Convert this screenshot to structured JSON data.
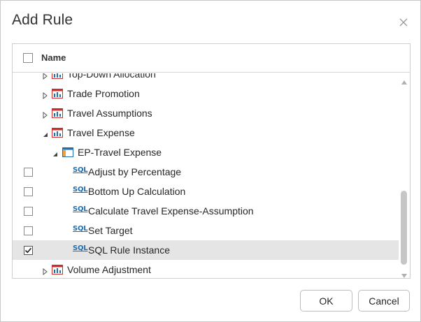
{
  "dialog": {
    "title": "Add Rule",
    "close_icon": "close-icon"
  },
  "grid": {
    "header": {
      "name_label": "Name",
      "select_all_checked": false
    },
    "rows": [
      {
        "label": "Top-Down Allocation",
        "type": "cube",
        "expanded": false,
        "icon": "cube-chart-icon"
      },
      {
        "label": "Trade Promotion",
        "type": "cube",
        "expanded": false,
        "icon": "cube-chart-icon"
      },
      {
        "label": "Travel Assumptions",
        "type": "cube",
        "expanded": false,
        "icon": "cube-chart-icon"
      },
      {
        "label": "Travel Expense",
        "type": "cube",
        "expanded": true,
        "icon": "cube-chart-icon"
      },
      {
        "label": "EP-Travel Expense",
        "type": "table",
        "expanded": true,
        "icon": "table-icon"
      },
      {
        "label": "Adjust by Percentage",
        "type": "sql",
        "checked": false,
        "icon": "sql-icon",
        "icon_text": "SQL"
      },
      {
        "label": "Bottom Up Calculation",
        "type": "sql",
        "checked": false,
        "icon": "sql-icon",
        "icon_text": "SQL"
      },
      {
        "label": "Calculate Travel Expense-Assumption",
        "type": "sql",
        "checked": false,
        "icon": "sql-icon",
        "icon_text": "SQL"
      },
      {
        "label": "Set Target",
        "type": "sql",
        "checked": false,
        "icon": "sql-icon",
        "icon_text": "SQL"
      },
      {
        "label": "SQL Rule Instance",
        "type": "sql",
        "checked": true,
        "selected": true,
        "icon": "sql-icon",
        "icon_text": "SQL"
      },
      {
        "label": "Volume Adjustment",
        "type": "cube",
        "expanded": false,
        "icon": "cube-chart-icon"
      }
    ]
  },
  "buttons": {
    "ok_label": "OK",
    "cancel_label": "Cancel"
  },
  "colors": {
    "accent": "#1f6fb2",
    "cube_icon_red": "#c9302c",
    "table_icon_orange": "#e8a33c",
    "selected_row": "#e5e5e5"
  }
}
